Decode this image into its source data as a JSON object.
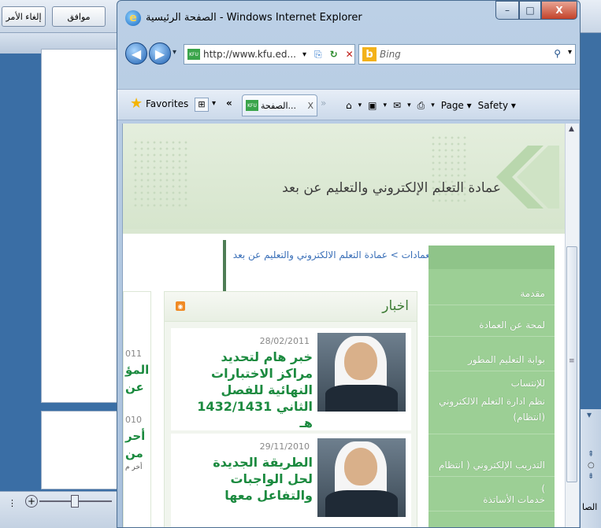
{
  "background_app": {
    "ok_button": "موافق",
    "cancel_button": "إلغاء الأمر"
  },
  "window": {
    "title": "الصفحة الرئيسية - Windows Internet Explorer",
    "minimize": "–",
    "maximize": "□",
    "close": "X"
  },
  "address_bar": {
    "url": "http://www.kfu.ed...",
    "favicon_label": "KFU"
  },
  "search": {
    "placeholder": "Bing"
  },
  "favorites_bar": {
    "favorites_label": "Favorites",
    "tab_label": "الصفحة...",
    "tab_close": "X",
    "commands": [
      "Page ▾",
      "Safety ▾"
    ]
  },
  "page": {
    "banner_title": "عمادة التعلم الإلكتروني والتعليم عن بعد",
    "breadcrumb": "الرئيسية  >  العمادات  >  عمادة التعلم الالكتروني والتعليم عن بعد",
    "sidebar_items": [
      "مقدمة",
      "لمحة عن العمادة",
      "بوابة التعليم المطور للإنتساب",
      "نظم ادارة التعلم الالكتروني (انتظام)",
      "التدريب الإلكتروني ( انتظام )",
      "خدمات الأساتذة"
    ],
    "news": {
      "title": "اخبار",
      "items": [
        {
          "date": "28/02/2011",
          "headline": "خبر هام لتحديد مراكز الاختبارات النهائية للفصل الثاني 1432/1431 هـ"
        },
        {
          "date": "29/11/2010",
          "headline": "الطريقة الجديدة لحل الواجبات والتفاعل معها"
        }
      ]
    },
    "left_column": {
      "date1": "011",
      "text1a": "المؤ",
      "text1b": "عن",
      "date2": "010",
      "text2a": "أحر",
      "text2b": "من",
      "text2c": "أخر م"
    }
  },
  "colors": {
    "accent_green": "#1b8a3f",
    "sidebar_green": "#9ccf95",
    "link_blue": "#3b70b8"
  }
}
